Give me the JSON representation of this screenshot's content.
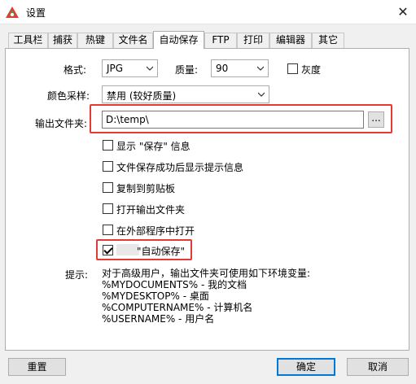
{
  "window": {
    "title": "设置"
  },
  "tabs": [
    {
      "label": "工具栏",
      "active": false
    },
    {
      "label": "捕获",
      "active": false
    },
    {
      "label": "热键",
      "active": false
    },
    {
      "label": "文件名",
      "active": false
    },
    {
      "label": "自动保存",
      "active": true
    },
    {
      "label": "FTP",
      "active": false
    },
    {
      "label": "打印",
      "active": false
    },
    {
      "label": "编辑器",
      "active": false
    },
    {
      "label": "其它",
      "active": false
    }
  ],
  "form": {
    "format_label": "格式:",
    "format_value": "JPG",
    "quality_label": "质量:",
    "quality_value": "90",
    "grayscale_label": "灰度",
    "grayscale_checked": false,
    "color_sampling_label": "颜色采样:",
    "color_sampling_value": "禁用 (较好质量)",
    "output_folder_label": "输出文件夹:",
    "output_folder_value": "D:\\temp\\",
    "browse_label": "..."
  },
  "options": [
    {
      "label": "显示 \"保存\" 信息",
      "checked": false
    },
    {
      "label": "文件保存成功后显示提示信息",
      "checked": false
    },
    {
      "label": "复制到剪贴板",
      "checked": false
    },
    {
      "label": "打开输出文件夹",
      "checked": false
    },
    {
      "label": "在外部程序中打开",
      "checked": false
    },
    {
      "label": "\"自动保存\"",
      "checked": true
    }
  ],
  "hint": {
    "label": "提示:",
    "lines": [
      "对于高级用户，输出文件夹可使用如下环境变量:",
      "%MYDOCUMENTS% - 我的文档",
      "%MYDESKTOP% - 桌面",
      "%COMPUTERNAME% - 计算机名",
      "%USERNAME% - 用户名"
    ]
  },
  "buttons": {
    "reset": "重置",
    "ok": "确定",
    "cancel": "取消"
  },
  "colors": {
    "highlight": "#e53935",
    "focus": "#0078d7"
  }
}
